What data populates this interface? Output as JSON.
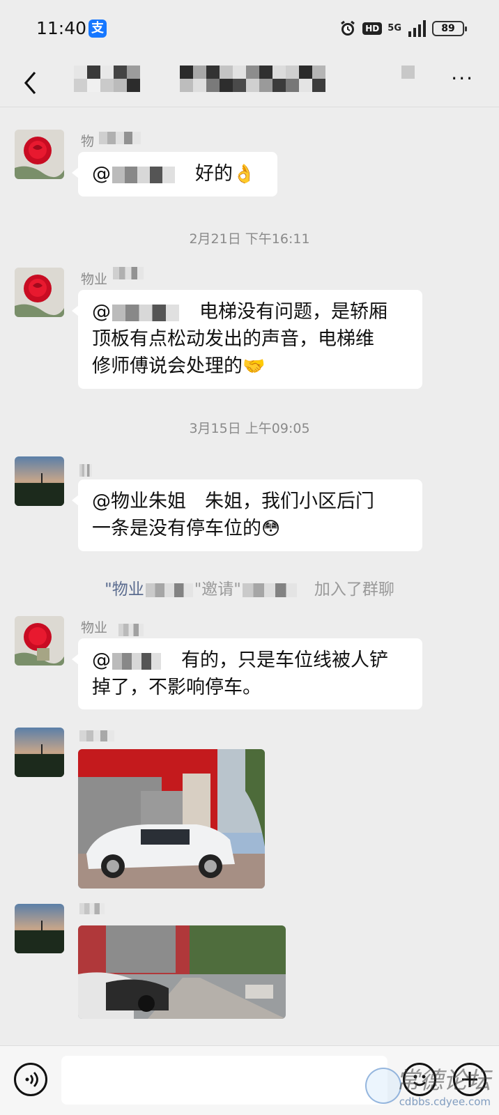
{
  "status_bar": {
    "time": "11:40",
    "pay_icon_glyph": "支",
    "hd_label": "HD",
    "network_label": "5G",
    "battery": "89"
  },
  "nav": {
    "more_label": "···"
  },
  "messages": [
    {
      "sender": "物",
      "text": "好的",
      "at_prefix": "@"
    },
    {
      "sender": "物业",
      "text_line1": "电梯没有问题，是轿厢",
      "text_line2": "顶板有点松动发出的声音，电梯维",
      "text_line3": "修师傅说会处理的",
      "at_prefix": "@"
    },
    {
      "sender": "",
      "text_line1": "@物业朱姐　朱姐，我们小区后门",
      "text_line2": "一条是没有停车位的"
    },
    {
      "sender": "物业",
      "text_line1": "有的，只是车位线被人铲",
      "text_line2": "掉了，不影响停车。",
      "at_prefix": "@"
    }
  ],
  "timestamps": [
    "2月21日 下午16:11",
    "3月15日 上午09:05"
  ],
  "system_notice": {
    "name_quote_open": "\"物业",
    "invite_text": "\"邀请\"",
    "joined_text": "加入了群聊"
  },
  "watermark": {
    "text": "常德论坛",
    "url": "cdbbs.cdyee.com"
  },
  "colors": {
    "background": "#ededed",
    "bubble": "#ffffff",
    "meta_text": "#8a8a8a",
    "link_name": "#5b6c8f"
  }
}
